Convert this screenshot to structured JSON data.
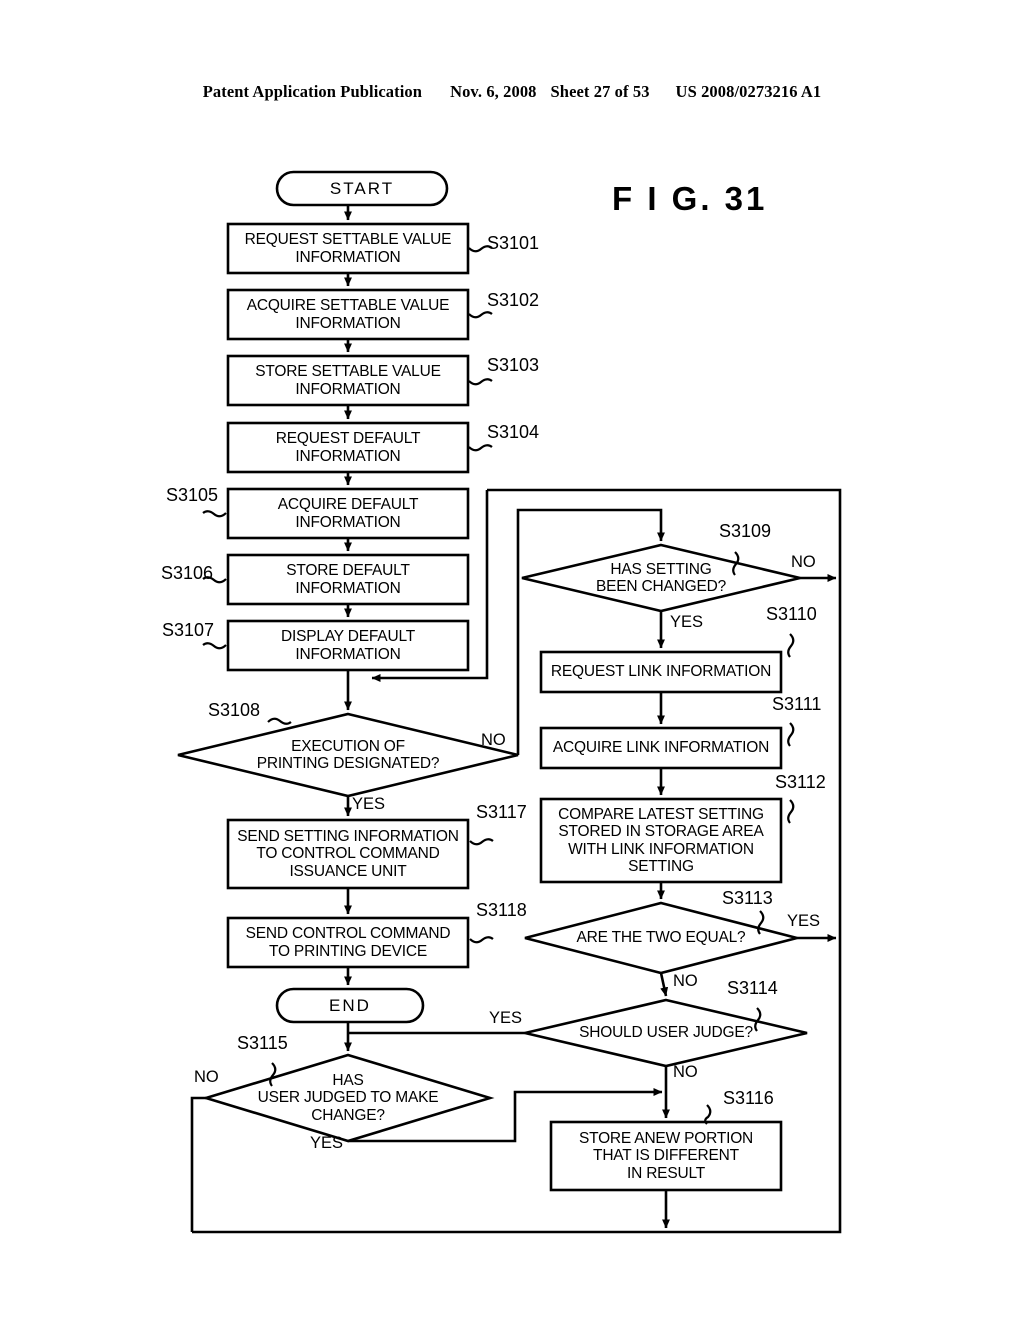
{
  "header": {
    "publication": "Patent Application Publication",
    "date": "Nov. 6, 2008",
    "sheet": "Sheet 27 of 53",
    "patent_number": "US 2008/0273216 A1"
  },
  "figure": {
    "title": "F I G.   31"
  },
  "chart_data": {
    "type": "diagram",
    "title": "F I G.   31",
    "diagram_kind": "flowchart",
    "nodes": [
      {
        "id": "start",
        "shape": "terminator",
        "label": "START",
        "step": null
      },
      {
        "id": "s3101",
        "shape": "process",
        "label": "REQUEST SETTABLE VALUE\nINFORMATION",
        "step": "S3101"
      },
      {
        "id": "s3102",
        "shape": "process",
        "label": "ACQUIRE SETTABLE VALUE\nINFORMATION",
        "step": "S3102"
      },
      {
        "id": "s3103",
        "shape": "process",
        "label": "STORE SETTABLE VALUE\nINFORMATION",
        "step": "S3103"
      },
      {
        "id": "s3104",
        "shape": "process",
        "label": "REQUEST DEFAULT\nINFORMATION",
        "step": "S3104"
      },
      {
        "id": "s3105",
        "shape": "process",
        "label": "ACQUIRE DEFAULT\nINFORMATION",
        "step": "S3105"
      },
      {
        "id": "s3106",
        "shape": "process",
        "label": "STORE DEFAULT\nINFORMATION",
        "step": "S3106"
      },
      {
        "id": "s3107",
        "shape": "process",
        "label": "DISPLAY DEFAULT\nINFORMATION",
        "step": "S3107"
      },
      {
        "id": "s3108",
        "shape": "decision",
        "label": "EXECUTION OF\nPRINTING DESIGNATED?",
        "step": "S3108"
      },
      {
        "id": "s3117",
        "shape": "process",
        "label": "SEND SETTING INFORMATION\nTO CONTROL COMMAND\nISSUANCE UNIT",
        "step": "S3117"
      },
      {
        "id": "s3118",
        "shape": "process",
        "label": "SEND CONTROL COMMAND\nTO PRINTING DEVICE",
        "step": "S3118"
      },
      {
        "id": "end",
        "shape": "terminator",
        "label": "END",
        "step": null
      },
      {
        "id": "s3115",
        "shape": "decision",
        "label": "HAS\nUSER JUDGED TO MAKE\nCHANGE?",
        "step": "S3115"
      },
      {
        "id": "s3109",
        "shape": "decision",
        "label": "HAS SETTING\nBEEN CHANGED?",
        "step": "S3109"
      },
      {
        "id": "s3110",
        "shape": "process",
        "label": "REQUEST LINK INFORMATION",
        "step": "S3110"
      },
      {
        "id": "s3111",
        "shape": "process",
        "label": "ACQUIRE LINK INFORMATION",
        "step": "S3111"
      },
      {
        "id": "s3112",
        "shape": "process",
        "label": "COMPARE LATEST SETTING\nSTORED IN STORAGE AREA\nWITH LINK INFORMATION\nSETTING",
        "step": "S3112"
      },
      {
        "id": "s3113",
        "shape": "decision",
        "label": "ARE THE TWO EQUAL?",
        "step": "S3113"
      },
      {
        "id": "s3114",
        "shape": "decision",
        "label": "SHOULD USER JUDGE?",
        "step": "S3114"
      },
      {
        "id": "s3116",
        "shape": "process",
        "label": "STORE ANEW PORTION\nTHAT IS DIFFERENT\nIN RESULT",
        "step": "S3116"
      }
    ],
    "edges": [
      {
        "from": "start",
        "to": "s3101",
        "label": ""
      },
      {
        "from": "s3101",
        "to": "s3102",
        "label": ""
      },
      {
        "from": "s3102",
        "to": "s3103",
        "label": ""
      },
      {
        "from": "s3103",
        "to": "s3104",
        "label": ""
      },
      {
        "from": "s3104",
        "to": "s3105",
        "label": ""
      },
      {
        "from": "s3105",
        "to": "s3106",
        "label": ""
      },
      {
        "from": "s3106",
        "to": "s3107",
        "label": ""
      },
      {
        "from": "s3107",
        "to": "s3108",
        "label": ""
      },
      {
        "from": "s3108",
        "to": "s3117",
        "label": "YES"
      },
      {
        "from": "s3108",
        "to": "s3109",
        "label": "NO"
      },
      {
        "from": "s3117",
        "to": "s3118",
        "label": ""
      },
      {
        "from": "s3118",
        "to": "end",
        "label": ""
      },
      {
        "from": "s3109",
        "to": "s3110",
        "label": "YES"
      },
      {
        "from": "s3109",
        "to": "s3105",
        "label": "NO"
      },
      {
        "from": "s3110",
        "to": "s3111",
        "label": ""
      },
      {
        "from": "s3111",
        "to": "s3112",
        "label": ""
      },
      {
        "from": "s3112",
        "to": "s3113",
        "label": ""
      },
      {
        "from": "s3113",
        "to": "s3105",
        "label": "YES"
      },
      {
        "from": "s3113",
        "to": "s3114",
        "label": "NO"
      },
      {
        "from": "s3114",
        "to": "s3115",
        "label": "YES"
      },
      {
        "from": "s3114",
        "to": "s3116",
        "label": "NO"
      },
      {
        "from": "s3115",
        "to": "s3116",
        "label": "YES"
      },
      {
        "from": "s3115",
        "to": "s3105",
        "label": "NO"
      },
      {
        "from": "s3116",
        "to": "s3105",
        "label": ""
      }
    ],
    "branch_labels": {
      "s3108_no": "NO",
      "s3108_yes": "YES",
      "s3109_no": "NO",
      "s3109_yes": "YES",
      "s3113_yes": "YES",
      "s3113_no": "NO",
      "s3114_yes": "YES",
      "s3114_no": "NO",
      "s3115_no": "NO",
      "s3115_yes": "YES"
    },
    "colors": {
      "stroke": "#000000",
      "fill": "#ffffff",
      "background": "#ffffff"
    }
  }
}
